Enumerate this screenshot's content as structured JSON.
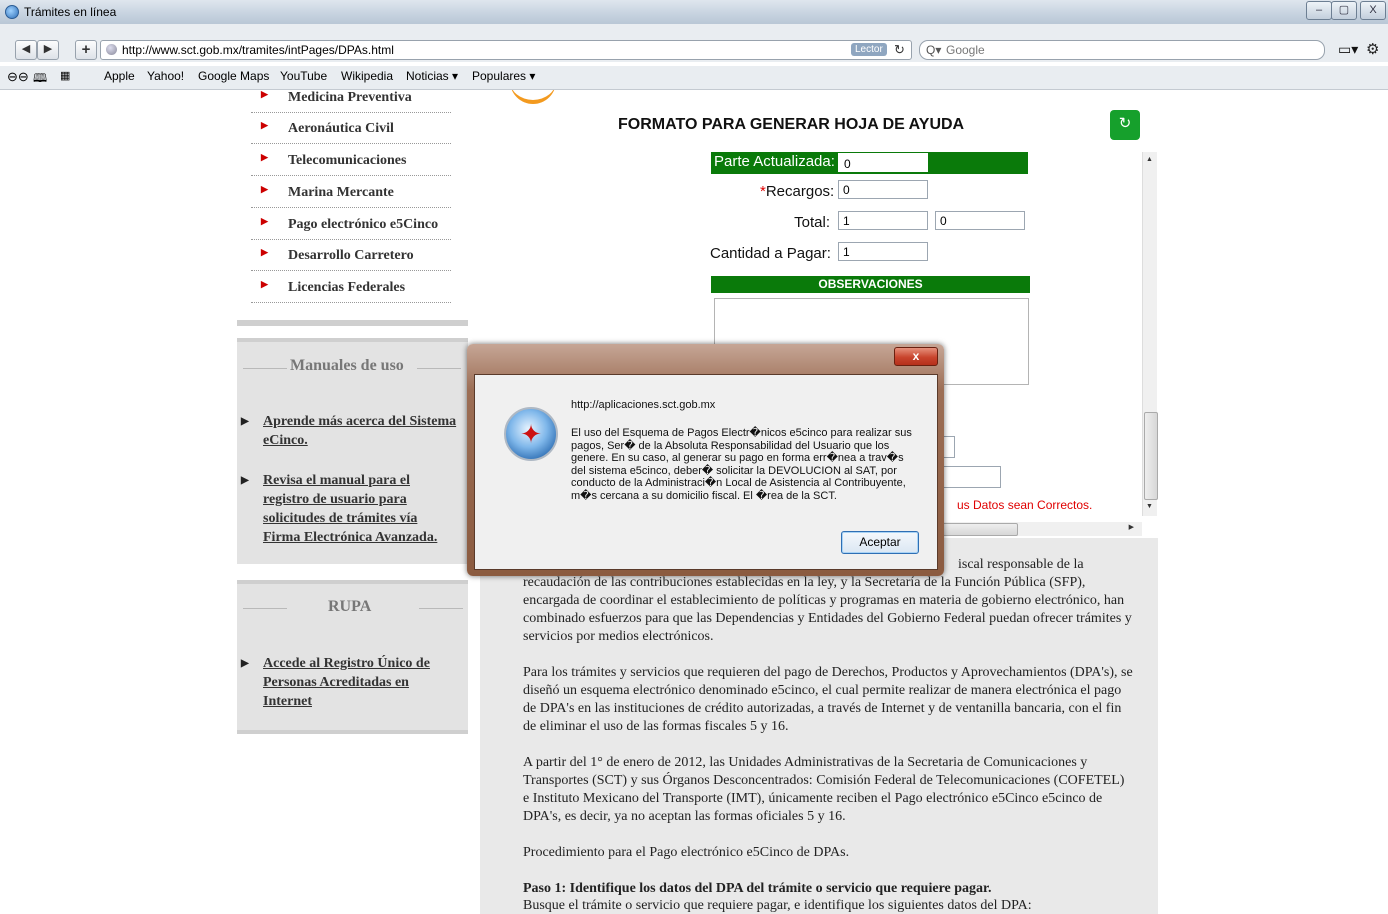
{
  "window": {
    "title": "Trámites en línea",
    "controls": [
      "–",
      "▢",
      "X"
    ]
  },
  "toolbar": {
    "back": "◀",
    "forward": "▶",
    "add": "+",
    "url": "http://www.sct.gob.mx/tramites/intPages/DPAs.html",
    "reader_label": "Lector",
    "search_placeholder": "Google"
  },
  "bookmarks": [
    "Apple",
    "Yahoo!",
    "Google Maps",
    "YouTube",
    "Wikipedia",
    "Noticias ▾",
    "Populares ▾"
  ],
  "sidebar": {
    "menu": [
      "Medicina Preventiva",
      "Aeronáutica Civil",
      "Telecomunicaciones",
      "Marina Mercante",
      "Pago electrónico e5Cinco",
      "Desarrollo Carretero",
      "Licencias Federales"
    ],
    "manuales": {
      "title": "Manuales de uso",
      "links": [
        "Aprende más acerca del Sistema eCinco.",
        "Revisa el manual para el registro de usuario para solicitudes de trámites vía Firma Electrónica Avanzada."
      ]
    },
    "rupa": {
      "title": "RUPA",
      "links": [
        "Accede al Registro Único de Personas Acreditadas en Internet"
      ]
    }
  },
  "form": {
    "title": "FORMATO PARA GENERAR HOJA DE AYUDA",
    "parte_label": "Parte Actualizada:",
    "parte_value": "0",
    "recargos_star": "*",
    "recargos_label": "Recargos:",
    "recargos_value": "0",
    "total_label": "Total:",
    "total_value": "1",
    "total_value2": "0",
    "cantidad_label": "Cantidad a Pagar:",
    "cantidad_value": "1",
    "observaciones": "OBSERVACIONES",
    "warning": "us Datos sean Correctos."
  },
  "body_text": {
    "p1_line1": "iscal responsable de la",
    "p1_rest": "recaudación de las contribuciones establecidas en la ley, y la Secretaría de la Función Pública (SFP), encargada de coordinar el establecimiento de políticas y programas en materia de gobierno electrónico, han combinado esfuerzos para que las Dependencias y Entidades del Gobierno Federal puedan ofrecer trámites y servicios por medios electrónicos.",
    "p2": "Para los trámites y servicios que requieren del pago de Derechos, Productos y Aprovechamientos (DPA's), se diseñó un esquema electrónico denominado e5cinco, el cual permite realizar de manera electrónica el pago de DPA's en las instituciones de crédito autorizadas, a través de Internet y de ventanilla bancaria, con el fin de eliminar el uso de las formas fiscales 5 y 16.",
    "p3": "A partir del 1° de enero de 2012, las Unidades Administrativas de la Secretaria de Comunicaciones y Transportes (SCT) y sus Órganos Desconcentrados: Comisión Federal de Telecomunicaciones (COFETEL) e Instituto Mexicano del Transporte (IMT), únicamente reciben el Pago electrónico e5Cinco e5cinco de DPA's, es decir, ya no aceptan las formas oficiales 5 y 16.",
    "p4": "Procedimiento para el Pago electrónico e5Cinco de DPAs.",
    "p5_title": "Paso 1: Identifique los datos del DPA del trámite o servicio que requiere pagar.",
    "p5_text": "Busque el trámite o servicio que requiere pagar, e identifique los siguientes datos del DPA:"
  },
  "dialog": {
    "close": "x",
    "host": "http://aplicaciones.sct.gob.mx",
    "message": "El uso del Esquema de Pagos Electr�nicos e5cinco para realizar sus pagos, Ser� de la Absoluta Responsabilidad del Usuario que los genere. En su caso, al generar su pago en forma err�nea a trav�s del sistema e5cinco, deber� solicitar la DEVOLUCION al SAT, por conducto de la Administraci�n Local de Asistencia al Contribuyente, m�s cercana a su domicilio fiscal. El �rea de la SCT.",
    "ok": "Aceptar"
  },
  "colors": {
    "green": "#0a7a0a",
    "warning_red": "#e00000",
    "menu_arrow": "#cc0000"
  }
}
